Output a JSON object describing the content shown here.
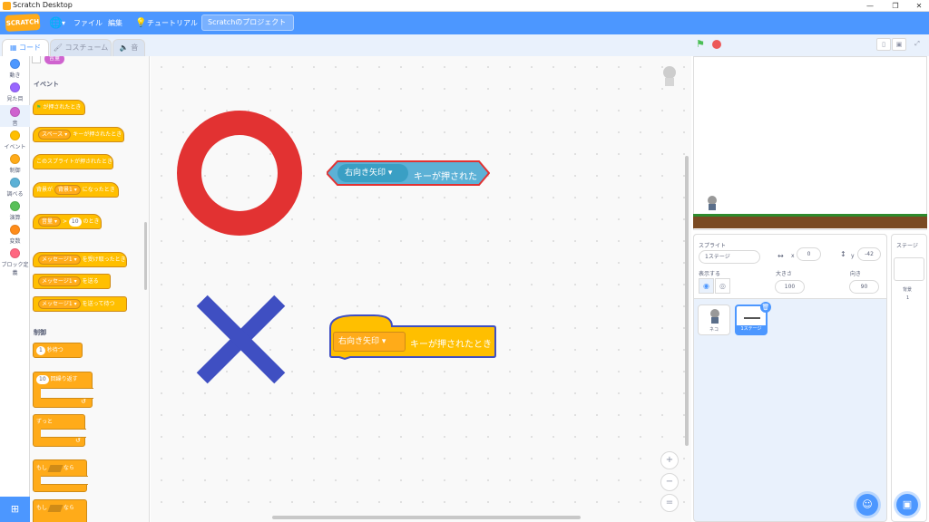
{
  "window": {
    "title": "Scratch Desktop",
    "minimize": "—",
    "maximize": "❐",
    "close": "✕"
  },
  "menubar": {
    "logo": "SCRATCH",
    "file": "ファイル",
    "edit": "編集",
    "tutorials": "チュートリアル",
    "project_title": "Scratchのプロジェクト",
    "globe_arrow": "▾"
  },
  "tabs": {
    "code": "コード",
    "costumes": "コスチューム",
    "sounds": "音"
  },
  "categories": [
    {
      "label": "動き",
      "color": "#4c97ff"
    },
    {
      "label": "見た目",
      "color": "#9966ff"
    },
    {
      "label": "音",
      "color": "#cf63cf"
    },
    {
      "label": "イベント",
      "color": "#ffbf00"
    },
    {
      "label": "制御",
      "color": "#ffab19"
    },
    {
      "label": "調べる",
      "color": "#5cb1d6"
    },
    {
      "label": "演算",
      "color": "#59c059"
    },
    {
      "label": "変数",
      "color": "#ff8c1a"
    },
    {
      "label": "ブロック定義",
      "color": "#ff6680"
    }
  ],
  "palette": {
    "events_heading": "イベント",
    "control_heading": "制御",
    "sound_chip": "音量",
    "b1": "が押されたとき",
    "b2_chip": "スペース",
    "b2_text": "キーが押されたとき",
    "b3": "このスプライトが押されたとき",
    "b4_pre": "背景が",
    "b4_chip": "背景1",
    "b4_post": "になったとき",
    "b5_chip": "音量",
    "b5_num": "10",
    "b5_post": "のとき",
    "b6_chip": "メッセージ1",
    "b6_post": "を受け取ったとき",
    "b7_chip": "メッセージ1",
    "b7_post": "を送る",
    "b8_chip": "メッセージ1",
    "b8_post": "を送って待つ",
    "c1_num": "1",
    "c1_post": "秒待つ",
    "c2_num": "10",
    "c2_post": "回繰り返す",
    "c3": "ずっと",
    "c4_pre": "もし",
    "c4_post": "なら",
    "c5_pre": "もし",
    "c5_post": "なら",
    "loop_arrow": "↺",
    "caret": "▾"
  },
  "canvas": {
    "sensing_key": "右向き矢印 ▾",
    "sensing_label": "キーが押された",
    "hat_key": "右向き矢印 ▾",
    "hat_label": "キーが押されたとき",
    "zoom_in": "+",
    "zoom_out": "−",
    "zoom_reset": "="
  },
  "sprite_info": {
    "sprite_label": "スプライト",
    "sprite_name": "1ステージ",
    "x_label": "x",
    "x_value": "0",
    "y_label": "y",
    "y_value": "-42",
    "show_label": "表示する",
    "size_label": "大きさ",
    "size_value": "100",
    "direction_label": "向き",
    "direction_value": "90"
  },
  "sprites": [
    {
      "name": "ネコ"
    },
    {
      "name": "1ステージ"
    }
  ],
  "stage_pane": {
    "title": "ステージ",
    "backdrops_label": "背景",
    "backdrops_count": "1"
  },
  "colors": {
    "accent": "#4c97ff",
    "events": "#ffbf00",
    "sensing": "#5cb1d6"
  }
}
